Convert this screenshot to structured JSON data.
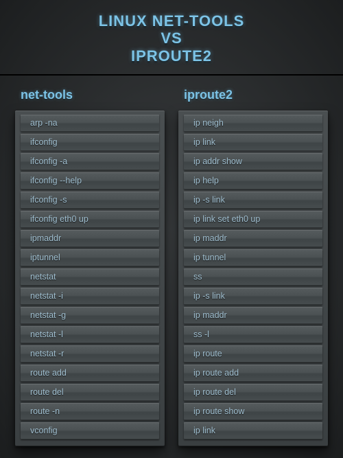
{
  "title": {
    "line1": "LINUX NET-TOOLS",
    "line2": "VS",
    "line3": "IPROUTE2"
  },
  "columns": {
    "left": {
      "header": "net-tools",
      "rows": [
        "arp -na",
        "ifconfig",
        "ifconfig -a",
        "ifconfig --help",
        "ifconfig -s",
        "ifconfig eth0 up",
        "ipmaddr",
        "iptunnel",
        "netstat",
        "netstat -i",
        "netstat  -g",
        "netstat -l",
        "netstat -r",
        "route add",
        "route del",
        "route -n",
        "vconfig"
      ]
    },
    "right": {
      "header": "iproute2",
      "rows": [
        "ip neigh",
        "ip link",
        "ip addr show",
        "ip help",
        "ip -s link",
        "ip link set eth0 up",
        "ip maddr",
        "ip tunnel",
        "ss",
        "ip -s link",
        "ip maddr",
        "ss -l",
        "ip route",
        "ip route add",
        "ip route del",
        "ip route show",
        "ip link"
      ]
    }
  }
}
